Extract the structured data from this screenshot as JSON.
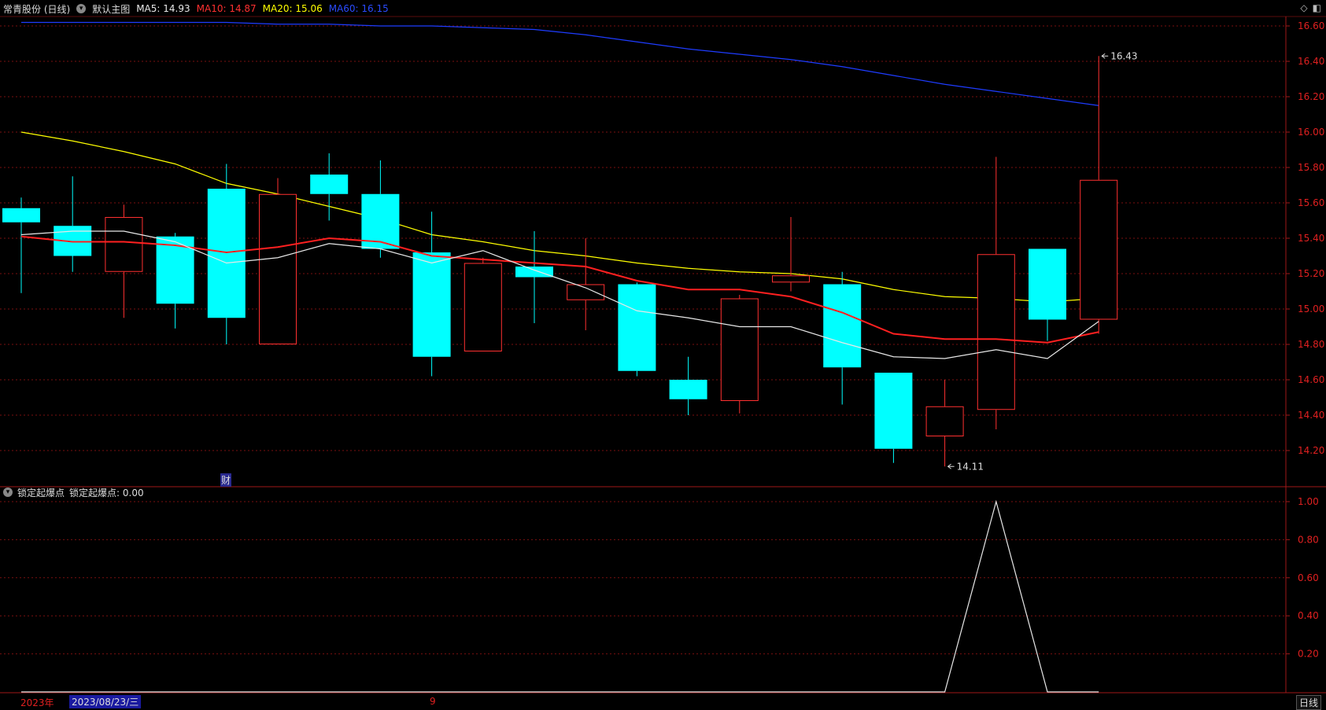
{
  "header": {
    "stock_name": "常青股份 (日线)",
    "template": "默认主图",
    "ma5": "MA5: 14.93",
    "ma10": "MA10: 14.87",
    "ma20": "MA20: 15.06",
    "ma60": "MA60: 16.15"
  },
  "sub_header": {
    "indicator_name": "锁定起爆点",
    "indicator_value": "锁定起爆点: 0.00"
  },
  "badge_fin": "财",
  "date_bar": {
    "year": "2023年",
    "current_date": "2023/08/23/三",
    "month_marker": "9",
    "period": "日线"
  },
  "colors": {
    "up": "#ff3030",
    "down": "#00ffff",
    "ma5": "#e8e8e8",
    "ma10": "#ff2020",
    "ma20": "#ffff00",
    "ma60": "#1e3cff",
    "grid": "#7a1010"
  },
  "chart_data": [
    {
      "type": "candlestick",
      "y_range": [
        14.05,
        16.7
      ],
      "y_ticks": [
        "16.60",
        "16.40",
        "16.20",
        "16.00",
        "15.80",
        "15.60",
        "15.40",
        "15.20",
        "15.00",
        "14.80",
        "14.60",
        "14.40",
        "14.20"
      ],
      "candles": [
        {
          "o": 15.57,
          "c": 15.49,
          "h": 15.63,
          "l": 15.09
        },
        {
          "o": 15.47,
          "c": 15.3,
          "h": 15.75,
          "l": 15.21
        },
        {
          "o": 15.21,
          "c": 15.52,
          "h": 15.59,
          "l": 14.95
        },
        {
          "o": 15.41,
          "c": 15.03,
          "h": 15.43,
          "l": 14.89
        },
        {
          "o": 15.68,
          "c": 14.95,
          "h": 15.82,
          "l": 14.8
        },
        {
          "o": 14.8,
          "c": 15.65,
          "h": 15.74,
          "l": 14.8
        },
        {
          "o": 15.76,
          "c": 15.65,
          "h": 15.88,
          "l": 15.5
        },
        {
          "o": 15.65,
          "c": 15.34,
          "h": 15.84,
          "l": 15.29
        },
        {
          "o": 15.32,
          "c": 14.73,
          "h": 15.55,
          "l": 14.62
        },
        {
          "o": 14.76,
          "c": 15.26,
          "h": 15.29,
          "l": 14.76
        },
        {
          "o": 15.24,
          "c": 15.18,
          "h": 15.44,
          "l": 14.92
        },
        {
          "o": 15.05,
          "c": 15.14,
          "h": 15.4,
          "l": 14.88
        },
        {
          "o": 15.14,
          "c": 14.65,
          "h": 15.15,
          "l": 14.62
        },
        {
          "o": 14.6,
          "c": 14.49,
          "h": 14.73,
          "l": 14.4
        },
        {
          "o": 14.48,
          "c": 15.06,
          "h": 15.08,
          "l": 14.41
        },
        {
          "o": 15.15,
          "c": 15.19,
          "h": 15.52,
          "l": 15.1
        },
        {
          "o": 15.14,
          "c": 14.67,
          "h": 15.21,
          "l": 14.46
        },
        {
          "o": 14.64,
          "c": 14.21,
          "h": 14.64,
          "l": 14.13
        },
        {
          "o": 14.28,
          "c": 14.45,
          "h": 14.6,
          "l": 14.11
        },
        {
          "o": 14.43,
          "c": 15.31,
          "h": 15.86,
          "l": 14.32
        },
        {
          "o": 15.34,
          "c": 14.94,
          "h": 15.34,
          "l": 14.82
        },
        {
          "o": 14.94,
          "c": 15.73,
          "h": 16.43,
          "l": 14.86
        }
      ],
      "ma5": [
        15.42,
        15.44,
        15.44,
        15.38,
        15.26,
        15.29,
        15.37,
        15.34,
        15.26,
        15.33,
        15.22,
        15.12,
        14.99,
        14.95,
        14.9,
        14.9,
        14.81,
        14.73,
        14.72,
        14.77,
        14.72,
        14.93
      ],
      "ma10": [
        15.41,
        15.38,
        15.38,
        15.36,
        15.32,
        15.35,
        15.4,
        15.38,
        15.3,
        15.28,
        15.26,
        15.24,
        15.16,
        15.11,
        15.11,
        15.07,
        14.98,
        14.86,
        14.83,
        14.83,
        14.81,
        14.87
      ],
      "ma20": [
        16.0,
        15.95,
        15.89,
        15.82,
        15.71,
        15.65,
        15.58,
        15.51,
        15.42,
        15.38,
        15.33,
        15.3,
        15.26,
        15.23,
        15.21,
        15.2,
        15.17,
        15.11,
        15.07,
        15.06,
        15.04,
        15.06
      ],
      "ma60": [
        16.62,
        16.62,
        16.62,
        16.62,
        16.62,
        16.61,
        16.61,
        16.6,
        16.6,
        16.59,
        16.58,
        16.55,
        16.51,
        16.47,
        16.44,
        16.41,
        16.37,
        16.32,
        16.27,
        16.23,
        16.19,
        16.15
      ],
      "annotations": [
        {
          "label": "16.43",
          "index": 21,
          "value": 16.43
        },
        {
          "label": "14.11",
          "index": 18,
          "value": 14.11
        }
      ]
    },
    {
      "type": "line",
      "name": "锁定起爆点",
      "y_range": [
        0,
        1.1
      ],
      "y_ticks": [
        "1.00",
        "0.80",
        "0.60",
        "0.40",
        "0.20"
      ],
      "values": [
        0,
        0,
        0,
        0,
        0,
        0,
        0,
        0,
        0,
        0,
        0,
        0,
        0,
        0,
        0,
        0,
        0,
        0,
        0,
        1,
        0,
        0
      ]
    }
  ]
}
